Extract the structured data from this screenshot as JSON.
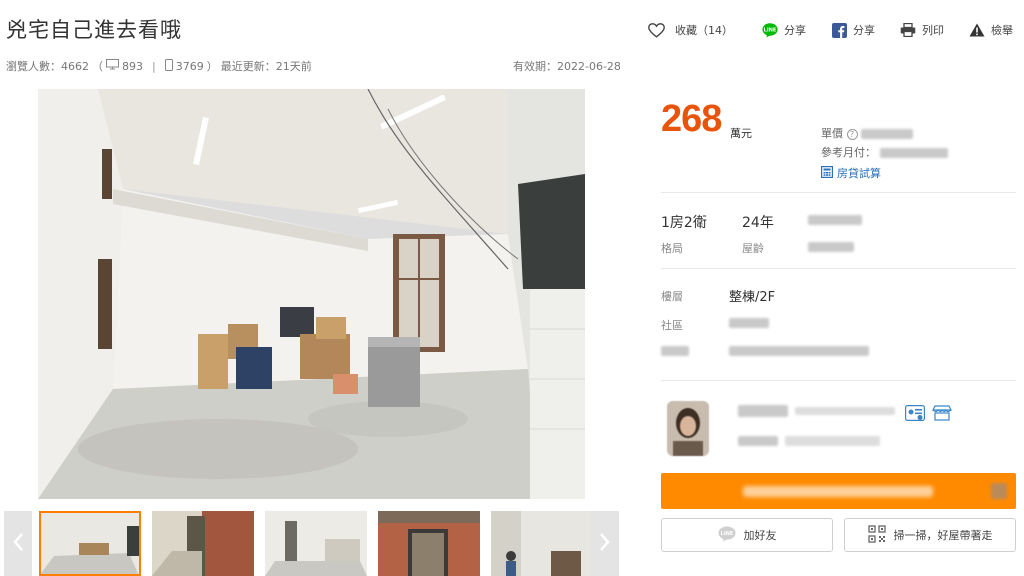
{
  "listing": {
    "title": "兇宅自己進去看哦",
    "views_label": "瀏覽人數：4662",
    "desktop_views": "893",
    "mobile_views": "3769",
    "stats_open": "（",
    "stats_close": "）",
    "stats_sep": "|",
    "updated": "最近更新：21天前",
    "expiry": "有效期：2022-06-28"
  },
  "actions": {
    "favorite": "收藏（14）",
    "line_share": "分享",
    "fb_share": "分享",
    "print": "列印",
    "report": "檢舉"
  },
  "price": {
    "amount": "268",
    "unit": "萬元",
    "unit_price_label": "單價",
    "monthly_label": "參考月付：",
    "calc_label": "房貸試算"
  },
  "specs": {
    "layout_value": "1房2衛",
    "layout_label": "格局",
    "age_value": "24年",
    "age_label": "屋齡",
    "floor_label": "樓層",
    "floor_value": "整棟/2F",
    "community_label": "社區"
  },
  "contact": {
    "line_friend": "加好友",
    "scan": "掃一掃，好屋帶著走"
  },
  "colors": {
    "accent": "#ff8a00",
    "price": "#e8540b",
    "link": "#2a6fb8"
  },
  "icons": {
    "favorite": "heart-icon",
    "line": "line-icon",
    "facebook": "facebook-icon",
    "print": "printer-icon",
    "report": "warning-icon",
    "desktop": "desktop-icon",
    "mobile": "mobile-icon",
    "calc": "calculator-icon",
    "prev": "chevron-left-icon",
    "next": "chevron-right-icon",
    "qr": "qr-code-icon"
  }
}
